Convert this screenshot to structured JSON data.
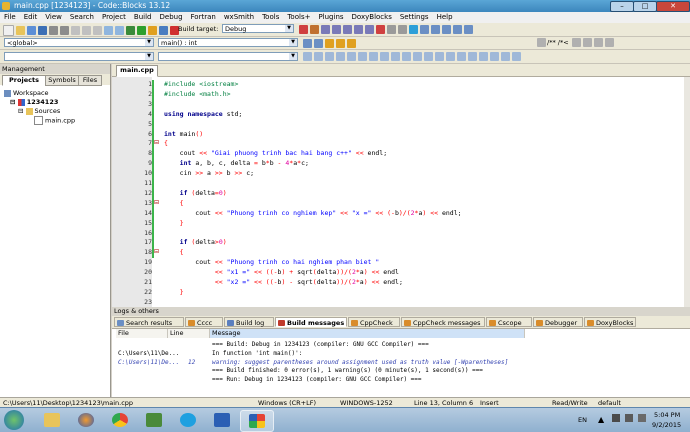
{
  "window": {
    "title": "main.cpp [1234123] - Code::Blocks 13.12"
  },
  "menu": [
    "File",
    "Edit",
    "View",
    "Search",
    "Project",
    "Build",
    "Debug",
    "Fortran",
    "wxSmith",
    "Tools",
    "Tools+",
    "Plugins",
    "DoxyBlocks",
    "Settings",
    "Help"
  ],
  "toolbar": {
    "build_target": "Debug",
    "scope": "<global>",
    "function": "main() : int"
  },
  "management": {
    "title": "Management",
    "tabs": [
      "Projects",
      "Symbols",
      "Files"
    ],
    "tree": {
      "workspace": "Workspace",
      "project": "1234123",
      "folder": "Sources",
      "file": "main.cpp"
    }
  },
  "editor": {
    "tab": "main.cpp",
    "lines": [
      {
        "n": "1",
        "html": "<span class='pp'>#include &lt;iostream&gt;</span>"
      },
      {
        "n": "2",
        "html": "<span class='pp'>#include &lt;math.h&gt;</span>"
      },
      {
        "n": "3",
        "html": ""
      },
      {
        "n": "4",
        "html": "<span class='kw'>using namespace</span> std;"
      },
      {
        "n": "5",
        "html": ""
      },
      {
        "n": "6",
        "html": "<span class='kw'>int</span> main<span class='op'>()</span>"
      },
      {
        "n": "7",
        "html": "<span class='op'>{</span>"
      },
      {
        "n": "8",
        "html": "    cout <span class='op'>&lt;&lt;</span> <span class='str'>\"Giai phuong trinh bac hai bang c++\"</span> <span class='op'>&lt;&lt;</span> endl;"
      },
      {
        "n": "9",
        "html": "    <span class='kw'>int</span> a, b, c, delta <span class='op'>=</span> b<span class='op'>*</span>b <span class='op'>-</span> <span class='num'>4</span><span class='op'>*</span>a<span class='op'>*</span>c;"
      },
      {
        "n": "10",
        "html": "    cin <span class='op'>&gt;&gt;</span> a <span class='op'>&gt;&gt;</span> b <span class='op'>&gt;&gt;</span> c;"
      },
      {
        "n": "11",
        "html": ""
      },
      {
        "n": "12",
        "html": "    <span class='kw'>if</span> <span class='op'>(</span>delta<span class='op'>=</span><span class='num'>0</span><span class='op'>)</span>"
      },
      {
        "n": "13",
        "html": "    <span class='op'>{</span>"
      },
      {
        "n": "14",
        "html": "        cout <span class='op'>&lt;&lt;</span> <span class='str'>\"Phuong trinh co nghiem kep\"</span> <span class='op'>&lt;&lt;</span> <span class='str'>\"x =\"</span> <span class='op'>&lt;&lt;</span> <span class='op'>(-</span>b<span class='op'>)/(</span><span class='num'>2</span><span class='op'>*</span>a<span class='op'>)</span> <span class='op'>&lt;&lt;</span> endl;"
      },
      {
        "n": "15",
        "html": "    <span class='op'>}</span>"
      },
      {
        "n": "16",
        "html": ""
      },
      {
        "n": "17",
        "html": "    <span class='kw'>if</span> <span class='op'>(</span>delta<span class='op'>&gt;</span><span class='num'>0</span><span class='op'>)</span>"
      },
      {
        "n": "18",
        "html": "    <span class='op'>{</span>"
      },
      {
        "n": "19",
        "html": "        cout <span class='op'>&lt;&lt;</span> <span class='str'>\"Phuong trinh co hai nghiem phan biet \"</span>"
      },
      {
        "n": "20",
        "html": "             <span class='op'>&lt;&lt;</span> <span class='str'>\"x1 =\"</span> <span class='op'>&lt;&lt;</span> <span class='op'>((-</span>b<span class='op'>)</span> <span class='op'>+</span> sqrt<span class='op'>(</span>delta<span class='op'>))/(</span><span class='num'>2</span><span class='op'>*</span>a<span class='op'>)</span> <span class='op'>&lt;&lt;</span> endl"
      },
      {
        "n": "21",
        "html": "             <span class='op'>&lt;&lt;</span> <span class='str'>\"x2 =\"</span> <span class='op'>&lt;&lt;</span> <span class='op'>((-</span>b<span class='op'>)</span> <span class='op'>-</span> sqrt<span class='op'>(</span>delta<span class='op'>))/(</span><span class='num'>2</span><span class='op'>*</span>a<span class='op'>)</span> <span class='op'>&lt;&lt;</span> endl;"
      },
      {
        "n": "22",
        "html": "    <span class='op'>}</span>"
      },
      {
        "n": "23",
        "html": ""
      }
    ]
  },
  "logs": {
    "title": "Logs & others",
    "tabs": [
      {
        "label": "Search results",
        "color": "#6b8fc4"
      },
      {
        "label": "Cccc",
        "color": "#d98c2b"
      },
      {
        "label": "Build log",
        "color": "#5b7fbf"
      },
      {
        "label": "Build messages",
        "color": "#c03a2b",
        "active": true
      },
      {
        "label": "CppCheck",
        "color": "#d98c2b"
      },
      {
        "label": "CppCheck messages",
        "color": "#d98c2b"
      },
      {
        "label": "Cscope",
        "color": "#d98c2b"
      },
      {
        "label": "Debugger",
        "color": "#d98c2b"
      },
      {
        "label": "DoxyBlocks",
        "color": "#d98c2b"
      }
    ],
    "columns": [
      "File",
      "Line",
      "Message"
    ],
    "rows": [
      {
        "file": "",
        "line": "",
        "msg": "=== Build: Debug in 1234123 (compiler: GNU GCC Compiler) ===",
        "color": "#000"
      },
      {
        "file": "C:\\Users\\11\\De...",
        "line": "",
        "msg": "In function 'int main()':",
        "color": "#000"
      },
      {
        "file": "C:\\Users\\11\\De...",
        "line": "12",
        "msg": "warning: suggest parentheses around assignment used as truth value [-Wparentheses]",
        "color": "#2f3fb0"
      },
      {
        "file": "",
        "line": "",
        "msg": "=== Build finished: 0 error(s), 1 warning(s) (0 minute(s), 1 second(s)) ===",
        "color": "#000"
      },
      {
        "file": "",
        "line": "",
        "msg": "=== Run: Debug in 1234123 (compiler: GNU GCC Compiler) ===",
        "color": "#000"
      }
    ]
  },
  "status": {
    "path": "C:\\Users\\11\\Desktop\\1234123\\main.cpp",
    "eol": "Windows (CR+LF)",
    "encoding": "WINDOWS-1252",
    "position": "Line 13, Column 6",
    "mode": "Insert",
    "access": "Read/Write",
    "profile": "default"
  },
  "taskbar": {
    "lang": "EN",
    "time": "5:04 PM",
    "date": "9/2/2015"
  }
}
